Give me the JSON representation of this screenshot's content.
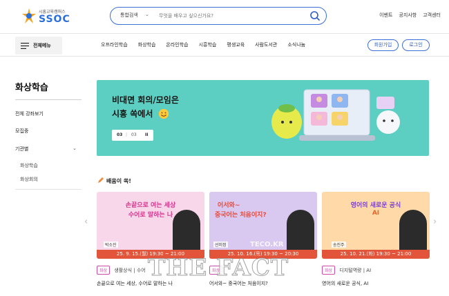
{
  "header": {
    "logo_sub": "시흥교육캠퍼스",
    "logo_main": "SSOC",
    "search": {
      "select_label": "통합검색",
      "placeholder": "무엇을 배우고 싶으신가요?"
    },
    "utility_links": [
      "이벤트",
      "공지사항",
      "고객센터"
    ]
  },
  "nav": {
    "all_menu": "전체메뉴",
    "items": [
      "오프라인학습",
      "화상학습",
      "온라인학습",
      "시흥학습",
      "평생교육",
      "사람도서관",
      "소식나눔"
    ],
    "join": "회원가입",
    "login": "로그인"
  },
  "sidebar": {
    "title": "화상학습",
    "items": [
      "전체 강좌보기",
      "모집중",
      "기관별"
    ],
    "sub_items": [
      "화상학습",
      "화상회의"
    ]
  },
  "banner": {
    "line1": "비대면 회의/모임은",
    "line2": "시흥 쏙에서",
    "pager_current": "03",
    "pager_total": "03",
    "pause": "II"
  },
  "section": {
    "title": "배움이 쏙!"
  },
  "cards": [
    {
      "title1": "손끝으로 여는 세상",
      "title2": "수어로 말하는 나",
      "name": "박소진",
      "date": "25. 9. 15.(월) 19:30 ~ 21:00",
      "tag": "화상",
      "meta": "생활상식 | 수어",
      "caption": "손끝으로 여는 세상, 수어로 말하는 나"
    },
    {
      "title1": "어서와~",
      "title2": "중국어는 처음이지?",
      "name": "선미정",
      "date": "25. 10. 16.(목) 19:30 ~ 20:30",
      "tag": "화상",
      "meta": "",
      "caption": "어서와~ 중국어는 처음이지?"
    },
    {
      "title1": "영어의 새로운 공식",
      "title2": "AI",
      "name": "송진주",
      "date": "25. 10. 21.(화) 19:30 ~ 21:00",
      "tag": "화상",
      "meta": "디지털역량 | AI",
      "caption": "영어의 새로운 공식, AI"
    }
  ],
  "watermark": "THE FACT",
  "watermark_small": "TECO.KR",
  "colors": {
    "accent": "#3a6fd8",
    "banner": "#5ccfc2",
    "tag": "#d14aa8",
    "date_bar": "#e2553a"
  }
}
